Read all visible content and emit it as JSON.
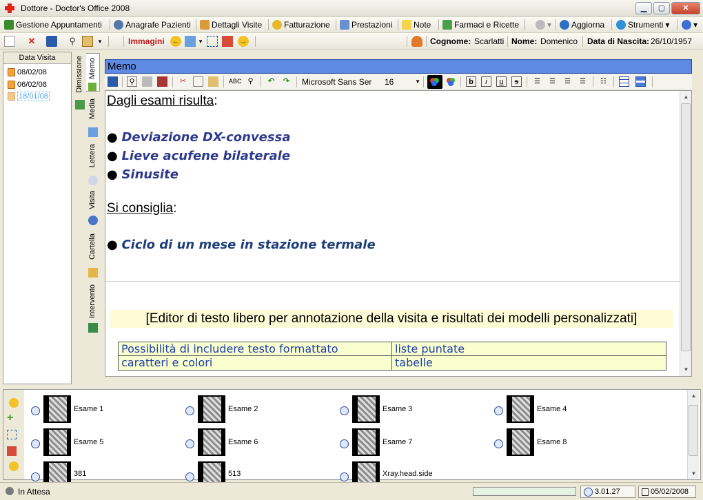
{
  "window": {
    "title": "Dottore - Doctor's Office 2008"
  },
  "menu": [
    {
      "label": "Gestione Appuntamenti",
      "icon": "calendar-icon"
    },
    {
      "label": "Anagrafe Pazienti",
      "icon": "people-icon"
    },
    {
      "label": "Dettagli Visite",
      "icon": "clipboard-icon"
    },
    {
      "label": "Fatturazione",
      "icon": "coin-icon"
    },
    {
      "label": "Prestazioni",
      "icon": "document-icon"
    },
    {
      "label": "Note",
      "icon": "note-icon"
    },
    {
      "label": "Farmaci e Ricette",
      "icon": "pills-icon"
    },
    {
      "label": "Aggiorna",
      "icon": "update-icon"
    },
    {
      "label": "Strumenti",
      "icon": "tools-icon"
    }
  ],
  "toolbar": {
    "images_label": "Immagini"
  },
  "patient": {
    "surname_label": "Cognome:",
    "surname": "Scarlatti",
    "name_label": "Nome:",
    "name": "Domenico",
    "dob_label": "Data di Nascita:",
    "dob": "26/10/1957"
  },
  "visits": {
    "header": "Data Visita",
    "items": [
      "08/02/08",
      "06/02/08",
      "18/01/08"
    ]
  },
  "vtabs": [
    "Memo",
    "Dimissione",
    "Media",
    "Lettera",
    "Visita",
    "Cartella",
    "Intervento"
  ],
  "memo": {
    "header": "Memo",
    "font": "Microsoft Sans Ser",
    "size": "16",
    "heading1": "Dagli esami risulta",
    "bullets1": [
      "Deviazione DX-convessa",
      "Lieve acufene bilaterale",
      "Sinusite"
    ],
    "heading2": "Si consiglia",
    "bullets2": [
      "Ciclo di un mese in stazione termale"
    ],
    "colon": ":",
    "notice": "[Editor di testo libero per annotazione della visita e risultati dei modelli personalizzati]",
    "table": [
      [
        "Possibilità di includere testo formattato",
        "liste puntate"
      ],
      [
        "caratteri e colori",
        "tabelle"
      ]
    ]
  },
  "images": [
    {
      "label": "Esame 1"
    },
    {
      "label": "Esame 2"
    },
    {
      "label": "Esame 3"
    },
    {
      "label": "Esame 4"
    },
    {
      "label": "Esame 5"
    },
    {
      "label": "Esame 6"
    },
    {
      "label": "Esame 7"
    },
    {
      "label": "Esame 8"
    },
    {
      "label": "381"
    },
    {
      "label": "513"
    },
    {
      "label": "Xray.head.side"
    }
  ],
  "status": {
    "text": "In Attesa",
    "version": "3.01.27",
    "date": "05/02/2008"
  }
}
